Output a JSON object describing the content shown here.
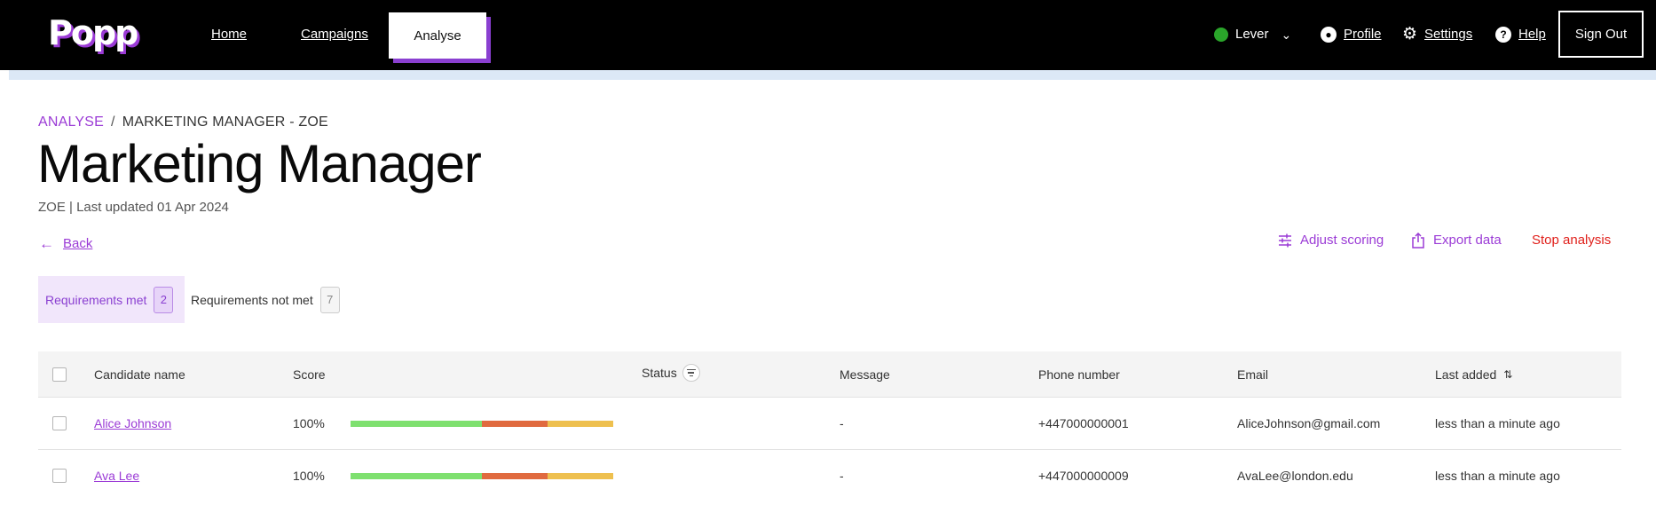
{
  "brand": {
    "logo": "Popp"
  },
  "nav": {
    "home": "Home",
    "campaigns": "Campaigns",
    "analyse": "Analyse",
    "integration": "Lever",
    "profile": "Profile",
    "settings": "Settings",
    "help": "Help",
    "sign_out": "Sign Out"
  },
  "header": {
    "breadcrumb_root": "ANALYSE",
    "breadcrumb_sep": "/",
    "breadcrumb_current": "MARKETING MANAGER - ZOE",
    "title": "Marketing Manager",
    "subtitle": "ZOE | Last updated 01 Apr 2024",
    "back": "Back"
  },
  "actions": {
    "adjust_scoring": "Adjust scoring",
    "export_data": "Export data",
    "stop_analysis": "Stop analysis"
  },
  "filters": [
    {
      "label": "Requirements met",
      "count": "2"
    },
    {
      "label": "Requirements not met",
      "count": "7"
    }
  ],
  "table": {
    "columns": [
      "Candidate name",
      "Score",
      "Status",
      "Message",
      "Phone number",
      "Email",
      "Last added"
    ],
    "rows": [
      {
        "name": "Alice Johnson",
        "score": "100%",
        "score_segments": [
          0.5,
          0.25,
          0.25
        ],
        "status": "",
        "message": "-",
        "phone": "+447000000001",
        "email": "AliceJohnson@gmail.com",
        "last_added": "less than a minute ago"
      },
      {
        "name": "Ava Lee",
        "score": "100%",
        "score_segments": [
          0.5,
          0.25,
          0.25
        ],
        "status": "",
        "message": "-",
        "phone": "+447000000009",
        "email": "AvaLee@london.edu",
        "last_added": "less than a minute ago"
      }
    ]
  },
  "colors": {
    "accent": "#9b3bd6",
    "danger": "#e0201b",
    "status_online": "#2aa52a",
    "score_green": "#7ee06f",
    "score_orange": "#e06a3f",
    "score_yellow": "#eec04f"
  },
  "icons": {
    "integration_status": "green-dot-icon",
    "profile": "user-circle-icon",
    "settings": "gear-icon",
    "help": "question-circle-icon",
    "back": "arrow-left-icon",
    "adjust": "sliders-icon",
    "export": "share-icon",
    "status_filter": "filter-icon",
    "sort": "sort-icon"
  }
}
